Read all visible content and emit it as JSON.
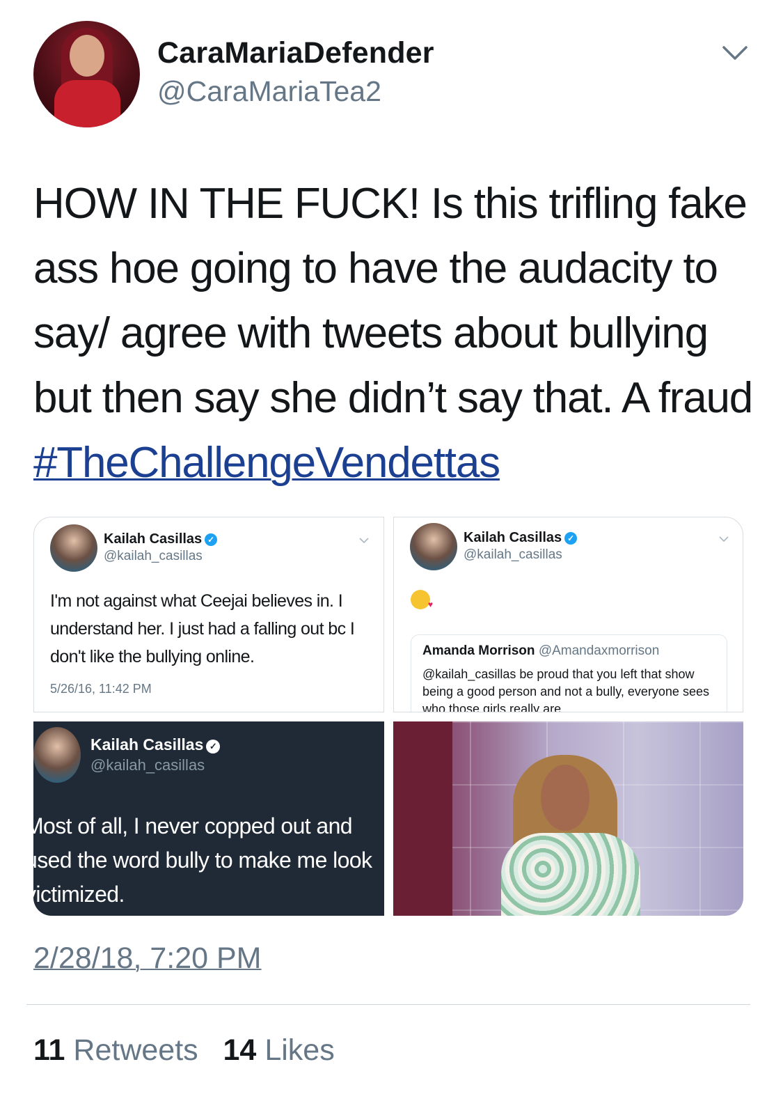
{
  "author": {
    "display_name": "CaraMariaDefender",
    "handle": "@CaraMariaTea2"
  },
  "tweet": {
    "text": "HOW IN THE FUCK! Is this trifling fake ass hoe going to have the audacity to say/ agree with tweets about bullying but then say she didn’t say that. A fraud ",
    "hashtag": "#TheChallengeVendettas",
    "timestamp": "2/28/18, 7:20 PM",
    "retweets_count": "11",
    "retweets_label": "Retweets",
    "likes_count": "14",
    "likes_label": "Likes"
  },
  "media": {
    "tile1": {
      "name": "Kailah Casillas",
      "handle": "@kailah_casillas",
      "text": "I'm not against what Ceejai believes in. I understand her. I just had a falling out bc I don't like the bullying online.",
      "time": "5/26/16, 11:42 PM"
    },
    "tile2": {
      "name": "Kailah Casillas",
      "handle": "@kailah_casillas",
      "quote_name": "Amanda Morrison",
      "quote_handle": "@Amandaxmorrison",
      "quote_text": "@kailah_casillas be proud that you left that show being a good person and not a bully, everyone sees who those girls really are"
    },
    "tile3": {
      "name": "Kailah Casillas",
      "handle": "@kailah_casillas",
      "text": "Most of all, I never copped out and used the word bully to make me look victimized."
    },
    "icons": {
      "verified": "verified-badge-icon",
      "chevron": "chevron-down-icon",
      "emoji": "kissing-face-emoji-icon"
    }
  },
  "colors": {
    "hashtag": "#1b3f91",
    "secondary_text": "#657786",
    "verified": "#1da1f2",
    "dark_tile": "#1f2a36"
  }
}
